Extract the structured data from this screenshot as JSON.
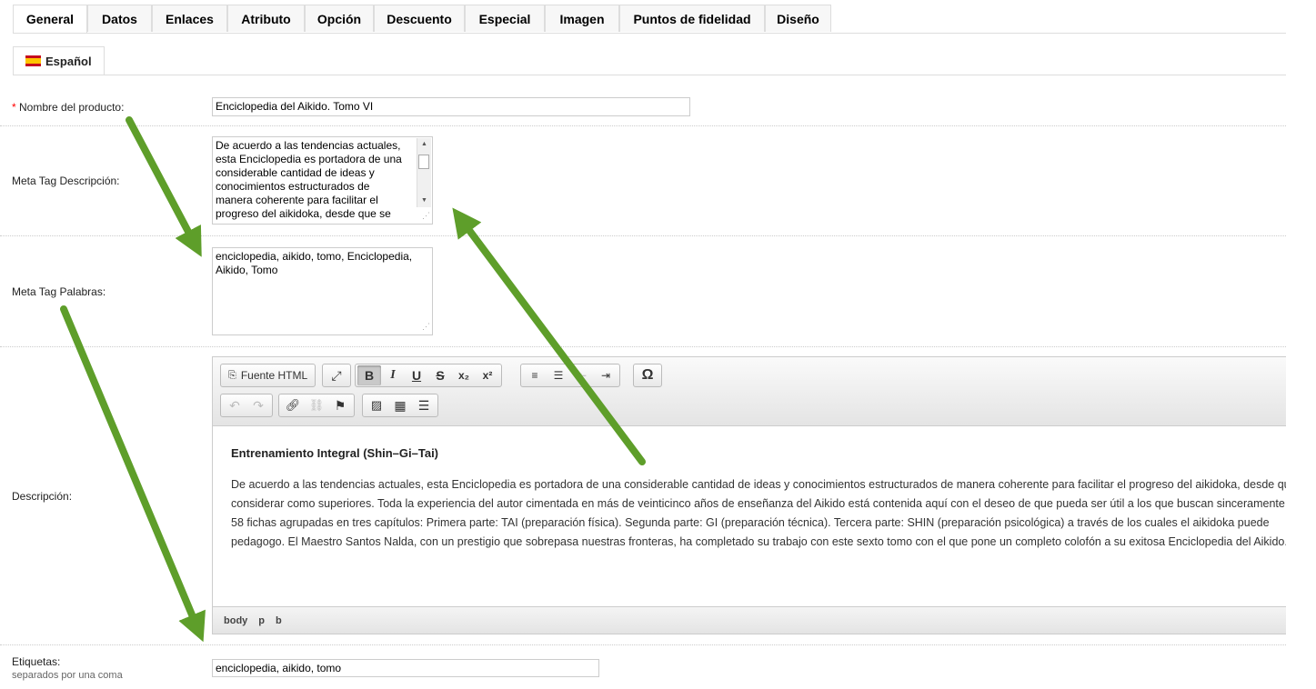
{
  "tabs": [
    "General",
    "Datos",
    "Enlaces",
    "Atributo",
    "Opción",
    "Descuento",
    "Especial",
    "Imagen",
    "Puntos de fidelidad",
    "Diseño"
  ],
  "language_tab": "Español",
  "fields": {
    "name_label": "Nombre del producto:",
    "name_required": "*",
    "name_value": "Enciclopedia del Aikido. Tomo VI",
    "meta_desc_label": "Meta Tag Descripción:",
    "meta_desc_lines": [
      "De acuerdo a las tendencias actuales,",
      "esta Enciclopedia es portadora de una",
      "considerable cantidad de ideas y",
      "conocimientos estructurados de",
      "manera coherente para facilitar el",
      "progreso del aikidoka, desde que se"
    ],
    "meta_kw_label": "Meta Tag Palabras:",
    "meta_kw_lines": [
      "enciclopedia, aikido, tomo, Enciclopedia,",
      "Aikido, Tomo"
    ],
    "desc_label": "Descripción:",
    "tags_label": "Etiquetas:",
    "tags_hint": "separados por una coma",
    "tags_value": "enciclopedia, aikido, tomo"
  },
  "editor": {
    "source_button": "Fuente HTML",
    "heading": "Entrenamiento Integral (Shin–Gi–Tai)",
    "paragraph_lines": [
      "De acuerdo a las tendencias actuales, esta Enciclopedia es portadora de una considerable cantidad de ideas y conocimientos estructurados de manera coherente para facilitar el progreso del aikidoka, desde que se",
      "considerar como superiores. Toda la experiencia del autor cimentada en más de veinticinco años de enseñanza del Aikido está contenida aquí con el deseo de que pueda ser útil a los que buscan sinceramente",
      "58 fichas agrupadas en tres capítulos: Primera parte: TAI (preparación física). Segunda parte: GI (preparación técnica). Tercera parte: SHIN (preparación psicológica) a través de los cuales el aikidoka puede",
      "pedagogo. El Maestro Santos Nalda, con un prestigio que sobrepasa nuestras fronteras, ha completado su trabajo con este sexto tomo con el que pone un completo colofón a su exitosa Enciclopedia del Aikido."
    ],
    "path": [
      "body",
      "p",
      "b"
    ]
  },
  "colors": {
    "arrow": "#5e9e2a",
    "required": "#ff0000"
  }
}
